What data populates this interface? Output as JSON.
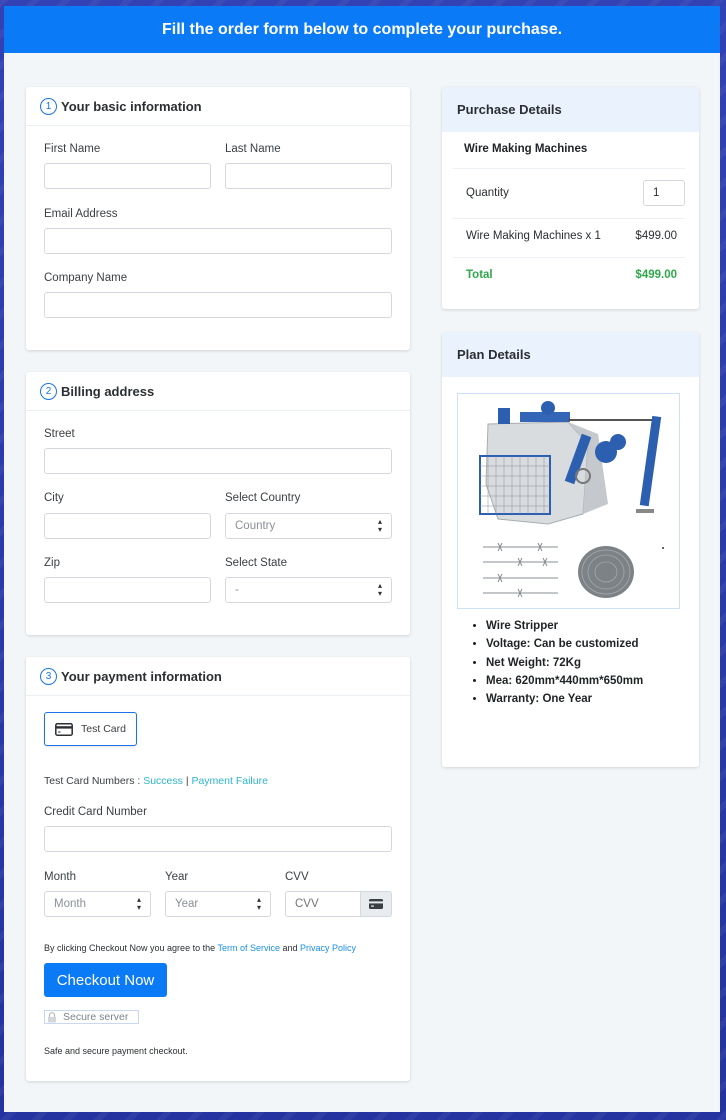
{
  "banner": {
    "title": "Fill the order form below to complete your purchase."
  },
  "basic_info": {
    "step": "1",
    "title": "Your basic information",
    "first_name_label": "First Name",
    "first_name_value": "",
    "last_name_label": "Last Name",
    "last_name_value": "",
    "email_label": "Email Address",
    "email_value": "",
    "company_label": "Company Name",
    "company_value": ""
  },
  "billing": {
    "step": "2",
    "title": "Billing address",
    "street_label": "Street",
    "city_label": "City",
    "country_label": "Select Country",
    "country_selected": "Country",
    "zip_label": "Zip",
    "state_label": "Select State",
    "state_selected": "-"
  },
  "payment": {
    "step": "3",
    "title": "Your payment information",
    "card_option_label": "Test Card",
    "test_numbers_label": "Test Card Numbers :",
    "success_link": "Success",
    "separator": "|",
    "failure_link": "Payment Failure",
    "cc_label": "Credit Card Number",
    "month_label": "Month",
    "month_selected": "Month",
    "year_label": "Year",
    "year_selected": "Year",
    "cvv_label": "CVV",
    "cvv_placeholder": "CVV",
    "agree_prefix": "By clicking Checkout Now you agree to the",
    "terms_link": "Term of Service",
    "agree_and": "and",
    "privacy_link": "Privacy Policy",
    "checkout_button": "Checkout Now",
    "secure_badge": "Secure server",
    "safe_note": "Safe and secure payment checkout."
  },
  "purchase": {
    "title": "Purchase Details",
    "product_name": "Wire Making Machines",
    "quantity_label": "Quantity",
    "quantity_value": "1",
    "line_item": "Wire Making Machines x 1",
    "line_price": "$499.00",
    "total_label": "Total",
    "total_value": "$499.00"
  },
  "plan": {
    "title": "Plan Details",
    "image_alt": "Barbed wire making machine with barbed wire samples",
    "features": [
      "Wire Stripper",
      "Voltage: Can be customized",
      "Net Weight: 72Kg",
      "Mea: 620mm*440mm*650mm",
      "Warranty: One Year"
    ]
  },
  "colors": {
    "brand_blue": "#0b7af6",
    "total_green": "#2ea84a",
    "link_blue": "#1a8ee8",
    "link_teal": "#2cb5c9"
  }
}
